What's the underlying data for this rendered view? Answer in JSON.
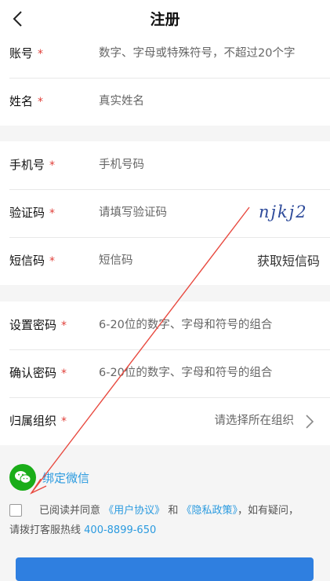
{
  "header": {
    "back_icon": "chevron-left-icon",
    "title": "注册"
  },
  "account": {
    "label": "账号",
    "placeholder": "数字、字母或特殊符号，不超过20个字"
  },
  "name": {
    "label": "姓名",
    "placeholder": "真实姓名"
  },
  "phone": {
    "label": "手机号",
    "placeholder": "手机号码"
  },
  "verify": {
    "label": "验证码",
    "placeholder": "请填写验证码",
    "captcha_text": "njkj2"
  },
  "sms": {
    "label": "短信码",
    "placeholder": "短信码",
    "button": "获取短信码"
  },
  "password": {
    "label": "设置密码",
    "placeholder": "6-20位的数字、字母和符号的组合"
  },
  "confirm": {
    "label": "确认密码",
    "placeholder": "6-20位的数字、字母和符号的组合"
  },
  "org": {
    "label": "归属组织",
    "placeholder": "请选择所在组织",
    "chevron_icon": "chevron-right-icon"
  },
  "required_mark": "*",
  "wechat": {
    "icon": "wechat-icon",
    "label": "绑定微信",
    "color": "#1aad19"
  },
  "agreement": {
    "prefix": "已阅读并同意",
    "user_agreement": "《用户协议》",
    "and": "和",
    "privacy": "《隐私政策》",
    "suffix": "，如有疑问，",
    "hotline_prefix": "请拨打客服热线",
    "hotline": "400-8899-650"
  },
  "colors": {
    "accent": "#2a9adf",
    "required": "#e0403a",
    "annotation_arrow": "#e8493f",
    "submit": "#2f7fe0"
  }
}
